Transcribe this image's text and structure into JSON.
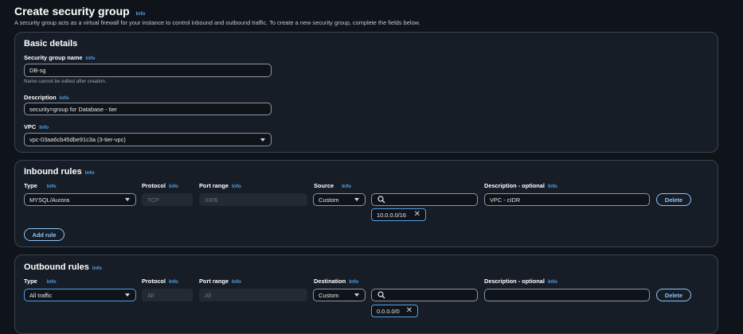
{
  "header": {
    "title": "Create security group",
    "info": "Info",
    "description": "A security group acts as a virtual firewall for your instance to control inbound and outbound traffic. To create a new security group, complete the fields below."
  },
  "basic": {
    "heading": "Basic details",
    "name_label": "Security group name",
    "name_value": "DB-sg",
    "name_hint": "Name cannot be edited after creation.",
    "desc_label": "Description",
    "desc_value": "security=group for Database - tier",
    "vpc_label": "VPC",
    "vpc_value": "vpc-03aa6cb45dbe91c3a (3-tier-vpc)"
  },
  "inbound": {
    "heading": "Inbound rules",
    "col_type": "Type",
    "col_protocol": "Protocol",
    "col_port": "Port range",
    "col_source": "Source",
    "col_desc": "Description - optional",
    "type_value": "MYSQL/Aurora",
    "protocol_value": "TCP",
    "port_value": "3306",
    "source_value": "Custom",
    "cidr_token": "10.0.0.0/16",
    "desc_value": "VPC - cIDR",
    "delete_label": "Delete",
    "add_rule_label": "Add rule"
  },
  "outbound": {
    "heading": "Outbound rules",
    "col_type": "Type",
    "col_protocol": "Protocol",
    "col_port": "Port range",
    "col_dest": "Destination",
    "col_desc": "Description - optional",
    "type_value": "All traffic",
    "protocol_value": "All",
    "port_value": "All",
    "dest_value": "Custom",
    "cidr_token": "0.0.0.0/0",
    "desc_value": "",
    "delete_label": "Delete"
  },
  "icons": [
    "search-icon",
    "close-icon",
    "chevron-down-icon"
  ],
  "colors": {
    "accent": "#539fe5",
    "button": "#8fc4f7",
    "background": "#0f141a",
    "panel": "#161d26"
  }
}
